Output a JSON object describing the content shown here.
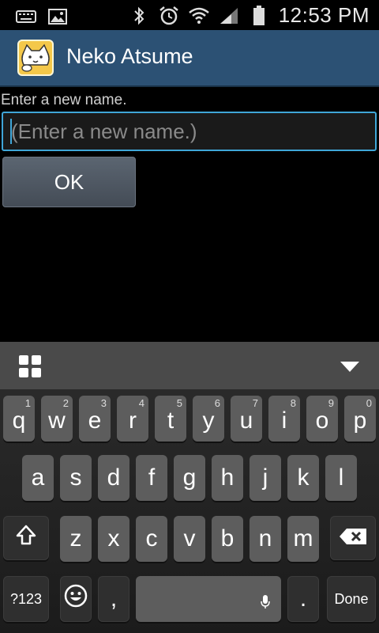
{
  "status_bar": {
    "time": "12:53 PM",
    "icons": [
      "keyboard-icon",
      "image-icon",
      "bluetooth-icon",
      "alarm-icon",
      "wifi-icon",
      "signal-icon",
      "battery-icon"
    ]
  },
  "action_bar": {
    "app_title": "Neko Atsume",
    "app_icon": "neko-atsume-app-icon"
  },
  "dialog": {
    "prompt": "Enter a new name.",
    "input_placeholder": "(Enter a new name.)",
    "input_value": "",
    "ok_label": "OK"
  },
  "keyboard": {
    "row1": [
      {
        "char": "q",
        "num": "1"
      },
      {
        "char": "w",
        "num": "2"
      },
      {
        "char": "e",
        "num": "3"
      },
      {
        "char": "r",
        "num": "4"
      },
      {
        "char": "t",
        "num": "5"
      },
      {
        "char": "y",
        "num": "6"
      },
      {
        "char": "u",
        "num": "7"
      },
      {
        "char": "i",
        "num": "8"
      },
      {
        "char": "o",
        "num": "9"
      },
      {
        "char": "p",
        "num": "0"
      }
    ],
    "row2": [
      "a",
      "s",
      "d",
      "f",
      "g",
      "h",
      "j",
      "k",
      "l"
    ],
    "row3": [
      "z",
      "x",
      "c",
      "v",
      "b",
      "n",
      "m"
    ],
    "symbols_label": "?123",
    "comma_label": ",",
    "period_label": ".",
    "done_label": "Done",
    "accent_color": "#3fa6d8"
  }
}
